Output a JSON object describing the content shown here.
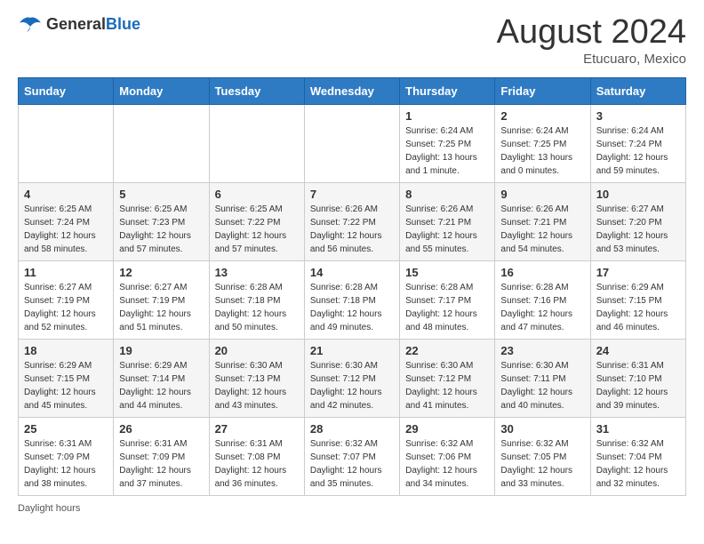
{
  "header": {
    "logo_general": "General",
    "logo_blue": "Blue",
    "month_title": "August 2024",
    "subtitle": "Etucuaro, Mexico"
  },
  "days_of_week": [
    "Sunday",
    "Monday",
    "Tuesday",
    "Wednesday",
    "Thursday",
    "Friday",
    "Saturday"
  ],
  "weeks": [
    [
      {
        "day": "",
        "info": ""
      },
      {
        "day": "",
        "info": ""
      },
      {
        "day": "",
        "info": ""
      },
      {
        "day": "",
        "info": ""
      },
      {
        "day": "1",
        "info": "Sunrise: 6:24 AM\nSunset: 7:25 PM\nDaylight: 13 hours\nand 1 minute."
      },
      {
        "day": "2",
        "info": "Sunrise: 6:24 AM\nSunset: 7:25 PM\nDaylight: 13 hours\nand 0 minutes."
      },
      {
        "day": "3",
        "info": "Sunrise: 6:24 AM\nSunset: 7:24 PM\nDaylight: 12 hours\nand 59 minutes."
      }
    ],
    [
      {
        "day": "4",
        "info": "Sunrise: 6:25 AM\nSunset: 7:24 PM\nDaylight: 12 hours\nand 58 minutes."
      },
      {
        "day": "5",
        "info": "Sunrise: 6:25 AM\nSunset: 7:23 PM\nDaylight: 12 hours\nand 57 minutes."
      },
      {
        "day": "6",
        "info": "Sunrise: 6:25 AM\nSunset: 7:22 PM\nDaylight: 12 hours\nand 57 minutes."
      },
      {
        "day": "7",
        "info": "Sunrise: 6:26 AM\nSunset: 7:22 PM\nDaylight: 12 hours\nand 56 minutes."
      },
      {
        "day": "8",
        "info": "Sunrise: 6:26 AM\nSunset: 7:21 PM\nDaylight: 12 hours\nand 55 minutes."
      },
      {
        "day": "9",
        "info": "Sunrise: 6:26 AM\nSunset: 7:21 PM\nDaylight: 12 hours\nand 54 minutes."
      },
      {
        "day": "10",
        "info": "Sunrise: 6:27 AM\nSunset: 7:20 PM\nDaylight: 12 hours\nand 53 minutes."
      }
    ],
    [
      {
        "day": "11",
        "info": "Sunrise: 6:27 AM\nSunset: 7:19 PM\nDaylight: 12 hours\nand 52 minutes."
      },
      {
        "day": "12",
        "info": "Sunrise: 6:27 AM\nSunset: 7:19 PM\nDaylight: 12 hours\nand 51 minutes."
      },
      {
        "day": "13",
        "info": "Sunrise: 6:28 AM\nSunset: 7:18 PM\nDaylight: 12 hours\nand 50 minutes."
      },
      {
        "day": "14",
        "info": "Sunrise: 6:28 AM\nSunset: 7:18 PM\nDaylight: 12 hours\nand 49 minutes."
      },
      {
        "day": "15",
        "info": "Sunrise: 6:28 AM\nSunset: 7:17 PM\nDaylight: 12 hours\nand 48 minutes."
      },
      {
        "day": "16",
        "info": "Sunrise: 6:28 AM\nSunset: 7:16 PM\nDaylight: 12 hours\nand 47 minutes."
      },
      {
        "day": "17",
        "info": "Sunrise: 6:29 AM\nSunset: 7:15 PM\nDaylight: 12 hours\nand 46 minutes."
      }
    ],
    [
      {
        "day": "18",
        "info": "Sunrise: 6:29 AM\nSunset: 7:15 PM\nDaylight: 12 hours\nand 45 minutes."
      },
      {
        "day": "19",
        "info": "Sunrise: 6:29 AM\nSunset: 7:14 PM\nDaylight: 12 hours\nand 44 minutes."
      },
      {
        "day": "20",
        "info": "Sunrise: 6:30 AM\nSunset: 7:13 PM\nDaylight: 12 hours\nand 43 minutes."
      },
      {
        "day": "21",
        "info": "Sunrise: 6:30 AM\nSunset: 7:12 PM\nDaylight: 12 hours\nand 42 minutes."
      },
      {
        "day": "22",
        "info": "Sunrise: 6:30 AM\nSunset: 7:12 PM\nDaylight: 12 hours\nand 41 minutes."
      },
      {
        "day": "23",
        "info": "Sunrise: 6:30 AM\nSunset: 7:11 PM\nDaylight: 12 hours\nand 40 minutes."
      },
      {
        "day": "24",
        "info": "Sunrise: 6:31 AM\nSunset: 7:10 PM\nDaylight: 12 hours\nand 39 minutes."
      }
    ],
    [
      {
        "day": "25",
        "info": "Sunrise: 6:31 AM\nSunset: 7:09 PM\nDaylight: 12 hours\nand 38 minutes."
      },
      {
        "day": "26",
        "info": "Sunrise: 6:31 AM\nSunset: 7:09 PM\nDaylight: 12 hours\nand 37 minutes."
      },
      {
        "day": "27",
        "info": "Sunrise: 6:31 AM\nSunset: 7:08 PM\nDaylight: 12 hours\nand 36 minutes."
      },
      {
        "day": "28",
        "info": "Sunrise: 6:32 AM\nSunset: 7:07 PM\nDaylight: 12 hours\nand 35 minutes."
      },
      {
        "day": "29",
        "info": "Sunrise: 6:32 AM\nSunset: 7:06 PM\nDaylight: 12 hours\nand 34 minutes."
      },
      {
        "day": "30",
        "info": "Sunrise: 6:32 AM\nSunset: 7:05 PM\nDaylight: 12 hours\nand 33 minutes."
      },
      {
        "day": "31",
        "info": "Sunrise: 6:32 AM\nSunset: 7:04 PM\nDaylight: 12 hours\nand 32 minutes."
      }
    ]
  ],
  "footer": {
    "daylight_label": "Daylight hours"
  }
}
